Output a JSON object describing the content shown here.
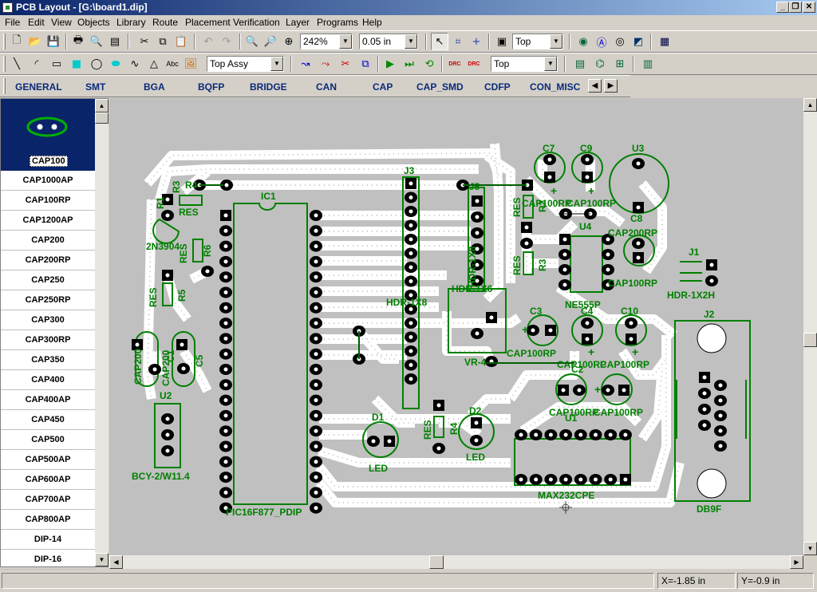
{
  "window": {
    "title": "PCB Layout - [G:\\board1.dip]"
  },
  "menu": [
    "File",
    "Edit",
    "View",
    "Objects",
    "Library",
    "Route",
    "Placement",
    "Verification",
    "Layer",
    "Programs",
    "Help"
  ],
  "toolbar1": {
    "zoom": "242%",
    "grid": "0.05 in",
    "layer": "Top"
  },
  "toolbar2": {
    "assy_layer": "Top Assy",
    "route_layer": "Top",
    "text_tool": "Abc"
  },
  "libtabs": [
    "GENERAL",
    "SMT",
    "BGA",
    "BQFP",
    "BRIDGE",
    "CAN",
    "CAP",
    "CAP_SMD",
    "CDFP",
    "CON_MISC"
  ],
  "library": {
    "selected": "CAP100",
    "items": [
      "CAP100",
      "CAP1000AP",
      "CAP100RP",
      "CAP1200AP",
      "CAP200",
      "CAP200RP",
      "CAP250",
      "CAP250RP",
      "CAP300",
      "CAP300RP",
      "CAP350",
      "CAP400",
      "CAP400AP",
      "CAP450",
      "CAP500",
      "CAP500AP",
      "CAP600AP",
      "CAP700AP",
      "CAP800AP",
      "DIP-14",
      "DIP-16"
    ]
  },
  "board": {
    "labels": [
      "R4",
      "RES",
      "R1",
      "2N3904",
      "R6",
      "RES",
      "R3",
      "RES",
      "R5",
      "IC1",
      "PIC16F877_PDIP",
      "J3",
      "HDR-1X8",
      "J5",
      "HDR-1X6",
      "HDR-1X8",
      "C7",
      "C9",
      "U3",
      "CAP100RP",
      "CAP100RP",
      "CAP200RP",
      "C8",
      "RES",
      "R2",
      "RES",
      "R3",
      "U4",
      "NE555P",
      "CAP100RP",
      "J1",
      "HDR-1X2H",
      "J2",
      "DB9F",
      "C3",
      "C4",
      "C10",
      "CAP100RP",
      "CAP100RP",
      "CAP100RP",
      "VR-4",
      "C2",
      "CAP100RP",
      "CAP100RP",
      "CAP200",
      "C1",
      "CAP200",
      "C5",
      "U2",
      "BCY-2/W11.4",
      "D1",
      "LED",
      "RES",
      "R4",
      "D2",
      "LED",
      "U1",
      "MAX232CPE"
    ]
  },
  "status": {
    "x": "X=-1.85 in",
    "y": "Y=-0.9 in"
  },
  "colors": {
    "title_start": "#0a246a",
    "title_end": "#a6caf0",
    "trace": "#ffffff",
    "silk": "#008000",
    "board_bg": "#c0c0c0",
    "pad": "#000000"
  }
}
